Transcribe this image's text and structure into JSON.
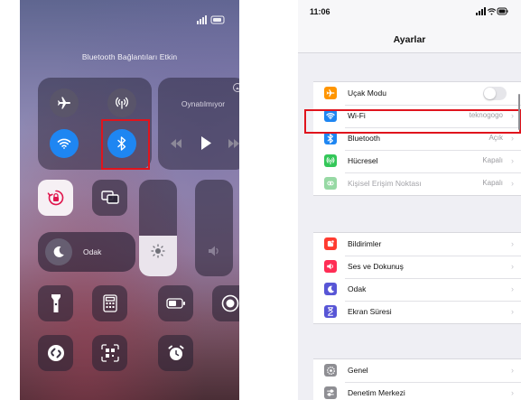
{
  "control_center": {
    "banner": "Bluetooth Bağlantıları Etkin",
    "now_playing": {
      "label": "Oynatılmıyor"
    },
    "focus": {
      "label": "Odak"
    },
    "brightness_level": 0.42,
    "volume_level": 0,
    "connectivity": {
      "bluetooth": "on",
      "wifi": "on",
      "airplane": "off",
      "cellular": "off"
    },
    "accent_color": "#1e86f2",
    "highlight_color": "#e0141d"
  },
  "settings": {
    "status_time": "11:06",
    "title": "Ayarlar",
    "groups": [
      [
        {
          "icon": "airplane-icon",
          "color": "#ff9500",
          "label": "Uçak Modu",
          "toggle": "off"
        },
        {
          "icon": "wifi-icon",
          "color": "#1e86f2",
          "label": "Wi-Fi",
          "value": "teknogogo"
        },
        {
          "icon": "bluetooth-icon",
          "color": "#1e86f2",
          "label": "Bluetooth",
          "value": "Açık"
        },
        {
          "icon": "cellular-icon",
          "color": "#34c759",
          "label": "Hücresel",
          "value": "Kapalı"
        },
        {
          "icon": "hotspot-icon",
          "color": "#97d9a4",
          "label": "Kişisel Erişim Noktası",
          "value": "Kapalı"
        }
      ],
      [
        {
          "icon": "notifications-icon",
          "color": "#ff3b30",
          "label": "Bildirimler"
        },
        {
          "icon": "sounds-icon",
          "color": "#ff2d55",
          "label": "Ses ve Dokunuş"
        },
        {
          "icon": "focus-icon",
          "color": "#5856d6",
          "label": "Odak"
        },
        {
          "icon": "screen-time-icon",
          "color": "#5856d6",
          "label": "Ekran Süresi"
        }
      ],
      [
        {
          "icon": "gear-icon",
          "color": "#8e8e93",
          "label": "Genel"
        },
        {
          "icon": "control-center-icon",
          "color": "#8e8e93",
          "label": "Denetim Merkezi"
        }
      ]
    ]
  }
}
